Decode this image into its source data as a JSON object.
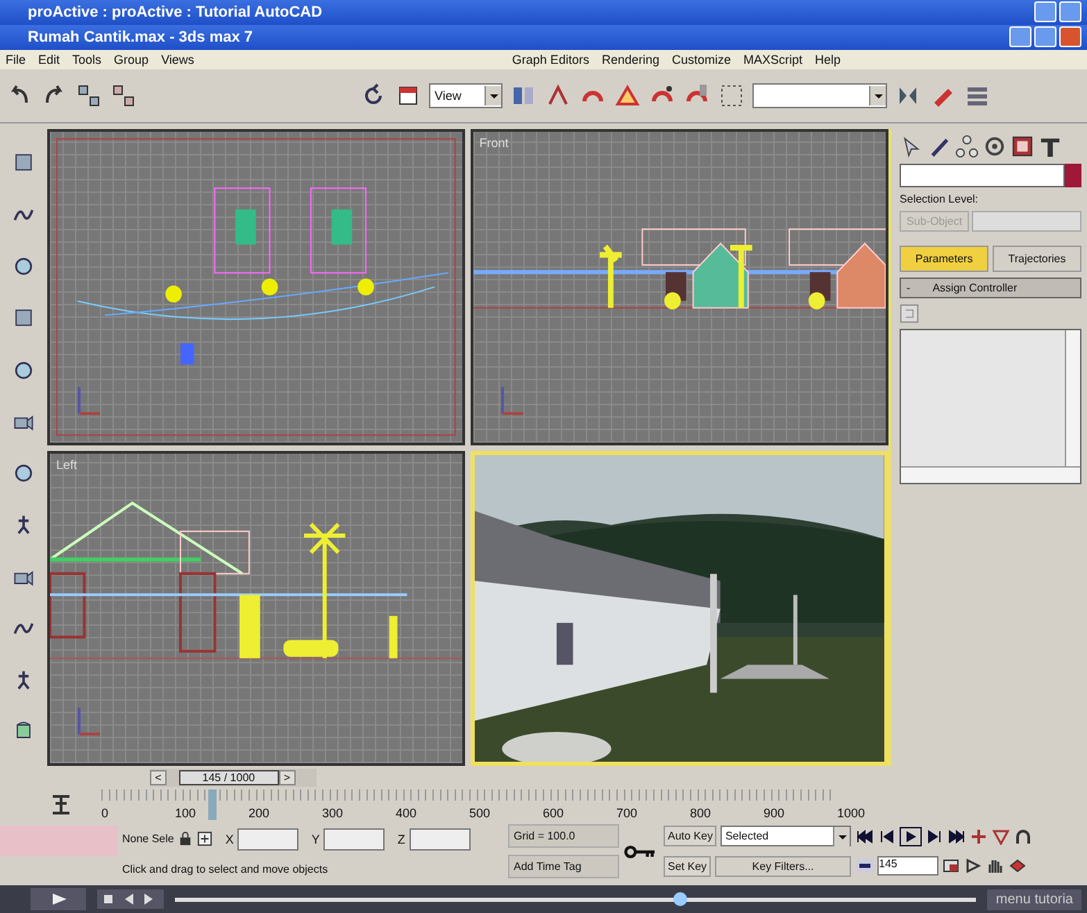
{
  "windows": [
    {
      "title": "proActive : proActive : Tutorial AutoCAD"
    },
    {
      "title": "Rumah Cantik.max - 3ds max 7"
    }
  ],
  "menu": [
    "File",
    "Edit",
    "Tools",
    "Group",
    "Views",
    "Graph Editors",
    "Rendering",
    "Customize",
    "MAXScript",
    "Help"
  ],
  "toolbar": {
    "view_dropdown": "View"
  },
  "viewports": [
    {
      "kind": "top",
      "selected": false
    },
    {
      "kind": "front",
      "label": "Front",
      "selected": false
    },
    {
      "kind": "left",
      "label": "Left",
      "selected": false
    },
    {
      "kind": "perspective",
      "selected": true
    }
  ],
  "command_panel": {
    "selection_level_label": "Selection Level:",
    "sub_object": "Sub-Object",
    "tabs": [
      {
        "label": "Parameters",
        "selected": true
      },
      {
        "label": "Trajectories",
        "selected": false
      }
    ],
    "rollout_sign": "-",
    "rollout": "Assign Controller"
  },
  "time_slider": {
    "frame": "145 / 1000",
    "level": 0.145,
    "prev": "<",
    "next": ">"
  },
  "ruler": [
    "0",
    "100",
    "200",
    "300",
    "400",
    "500",
    "600",
    "700",
    "800",
    "900",
    "1000"
  ],
  "status": {
    "selection": "None Sele",
    "x_label": "X",
    "y_label": "Y",
    "z_label": "Z",
    "grid": "Grid = 100.0",
    "prompt": "Click and drag to select and move objects",
    "add_time_tag": "Add Time Tag",
    "auto_key": "Auto Key",
    "key_mode": "Selected",
    "set_key": "Set Key",
    "key_filters": "Key Filters...",
    "frame": "145"
  },
  "player": {
    "level": 0.63,
    "label": "menu tutoria"
  }
}
